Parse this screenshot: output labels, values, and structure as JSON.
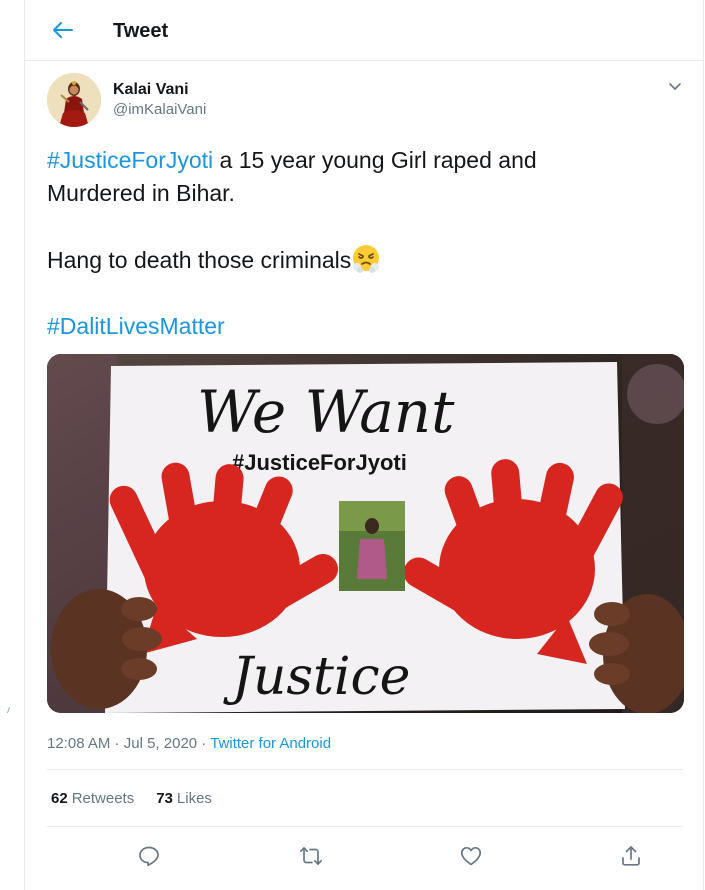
{
  "header": {
    "title": "Tweet"
  },
  "author": {
    "display_name": "Kalai Vani",
    "handle": "@imKalaiVani"
  },
  "tweet": {
    "hashtag1": "#JusticeForJyoti",
    "line1_rest": " a 15 year young Girl raped and",
    "line2": "Murdered in Bihar.",
    "line3": "Hang to death those criminals",
    "hashtag2": "#DalitLivesMatter"
  },
  "media": {
    "sign_heading": "We Want",
    "sign_hashtag": "#JusticeForJyoti",
    "sign_footer": "Justice"
  },
  "meta": {
    "time": "12:08 AM",
    "sep1": " · ",
    "date": "Jul 5, 2020",
    "sep2": " · ",
    "source": "Twitter for Android"
  },
  "stats": {
    "retweets_count": "62",
    "retweets_label": "Retweets",
    "likes_count": "73",
    "likes_label": "Likes"
  },
  "colors": {
    "link": "#1b95e0",
    "secondary_text": "#657786",
    "border": "#e6ecf0",
    "hand_red": "#d7261f"
  },
  "icons": {
    "back": "arrow-left-icon",
    "more": "chevron-down-icon",
    "reply": "reply-icon",
    "retweet": "retweet-icon",
    "like": "heart-icon",
    "share": "share-icon",
    "emoji": "steam-from-nose-emoji"
  }
}
